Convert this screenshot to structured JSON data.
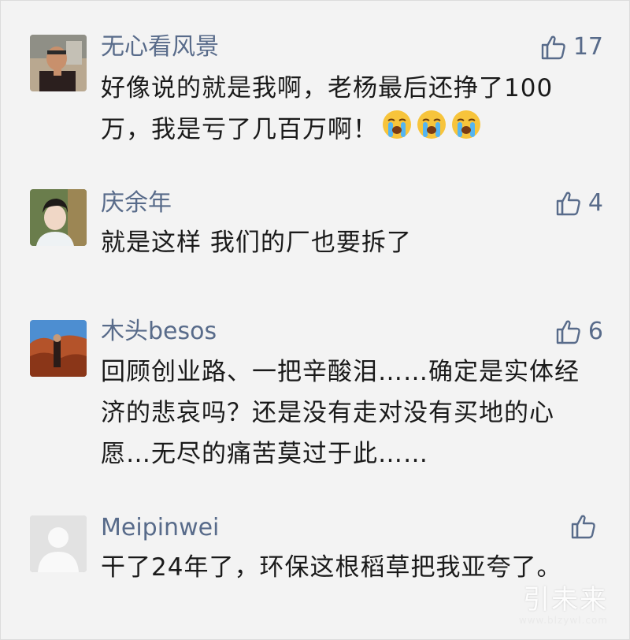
{
  "comments": [
    {
      "username": "无心看风景",
      "likes": "17",
      "text": "好像说的就是我啊，老杨最后还挣了100万，我是亏了几百万啊！",
      "emoji_count": 3,
      "emoji": "crying-face-icon"
    },
    {
      "username": "庆余年",
      "likes": "4",
      "text": "就是这样 我们的厂也要拆了"
    },
    {
      "username": "木头besos",
      "likes": "6",
      "text": "回顾创业路、一把辛酸泪……确定是实体经济的悲哀吗？还是没有走对没有买地的心愿…无尽的痛苦莫过于此……"
    },
    {
      "username": "Meipinwei",
      "likes": "",
      "text": "干了24年了，环保这根稻草把我亚夸了。"
    }
  ],
  "watermark": {
    "brand": "引未来",
    "site": "www.blzywl.com"
  },
  "colors": {
    "username": "#586b8a",
    "text": "#1a1a1a",
    "background": "#f3f3f3"
  }
}
